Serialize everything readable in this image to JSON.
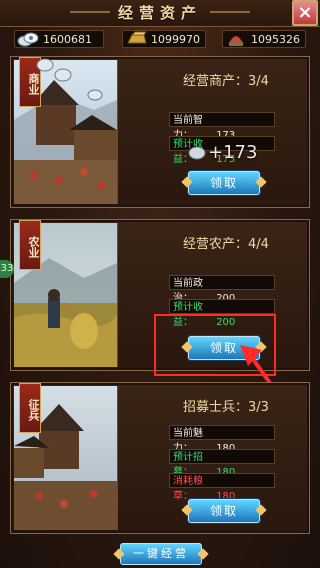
{
  "header": {
    "title": "经营资产",
    "close_icon": "close-icon"
  },
  "resources": [
    {
      "icon": "silver-ingot-icon",
      "value": "1600681"
    },
    {
      "icon": "gold-bar-icon",
      "value": "1099970"
    },
    {
      "icon": "soldier-helmet-icon",
      "value": "1095326"
    }
  ],
  "cards": [
    {
      "tag": "商业",
      "title": "经营商产：3/4",
      "stats": [
        {
          "label": "当前智力：",
          "value": "173"
        },
        {
          "label": "预计收益：",
          "value": "173"
        }
      ],
      "button": "领取",
      "popup": "+173"
    },
    {
      "tag": "农业",
      "title": "经营农产：4/4",
      "stats": [
        {
          "label": "当前政治：",
          "value": "200"
        },
        {
          "label": "预计收益：",
          "value": "200"
        }
      ],
      "button": "领取"
    },
    {
      "tag": "征兵",
      "title": "招募士兵：3/3",
      "stats": [
        {
          "label": "当前魅力：",
          "value": "180"
        },
        {
          "label": "预计招募：",
          "value": "180"
        },
        {
          "label": "消耗粮草：",
          "value": "180"
        }
      ],
      "button": "领取"
    }
  ],
  "side_badge": "33",
  "footer": {
    "button": "一键经营"
  },
  "colors": {
    "accent_red": "#ff2a2a",
    "gain_green": "#2fe06b",
    "cost_red": "#ff4a4a"
  }
}
